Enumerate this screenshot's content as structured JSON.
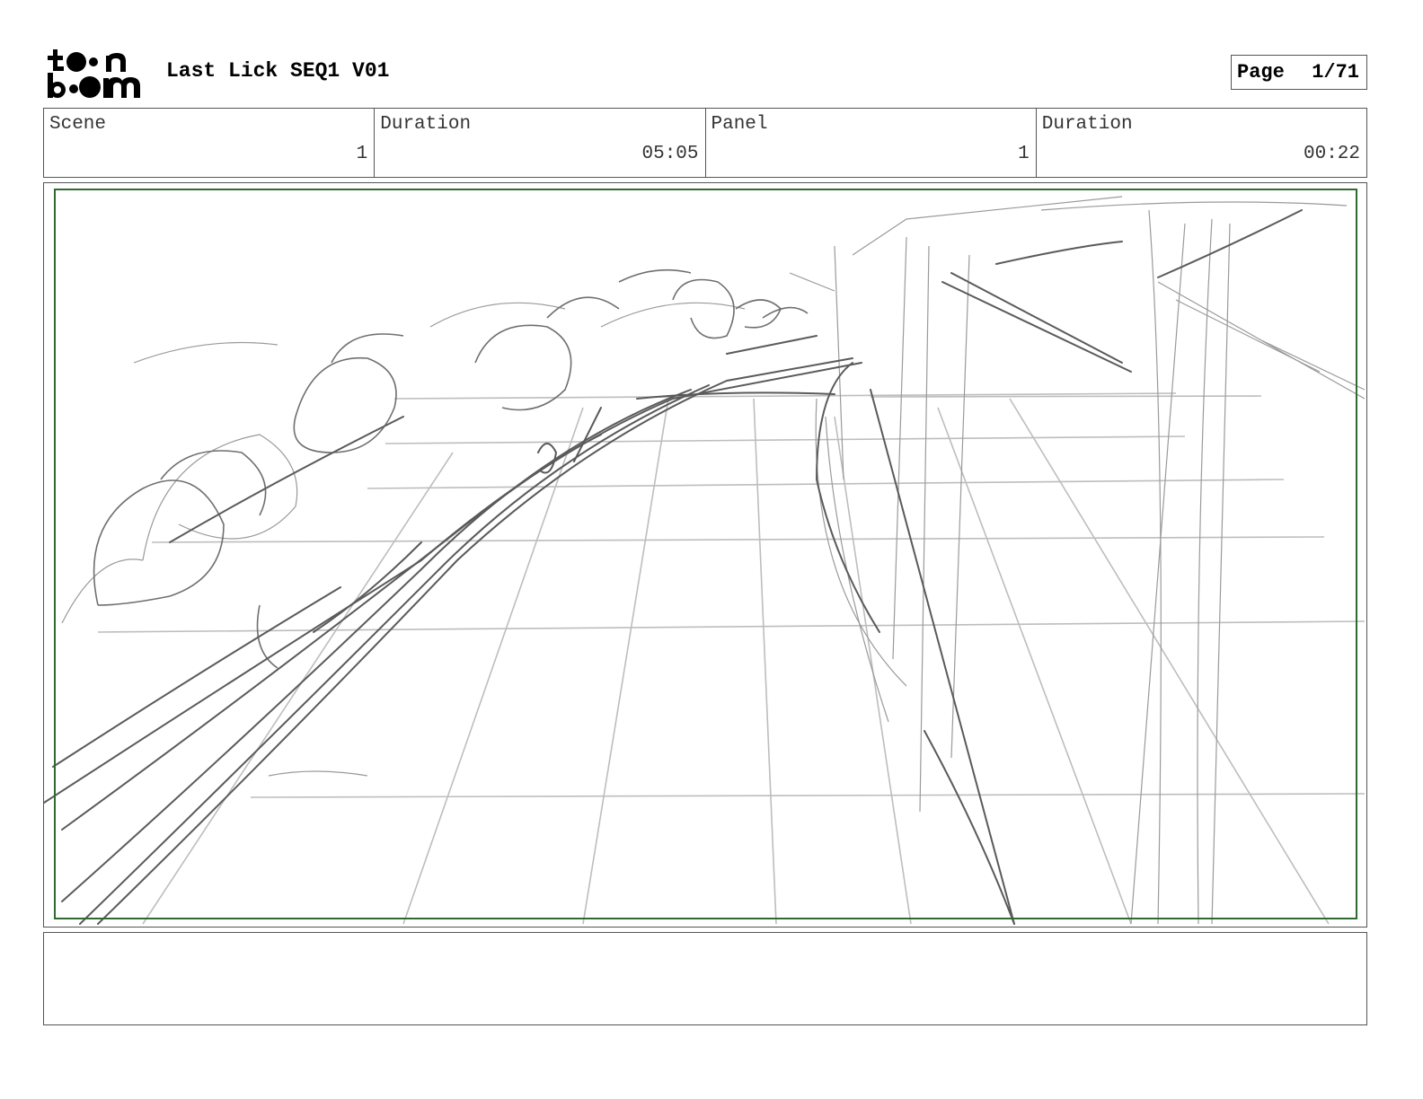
{
  "header": {
    "logo_text": "toon boom",
    "project_title": "Last Lick SEQ1 V01",
    "page_label": "Page",
    "page_number": "1/71"
  },
  "info": {
    "scene_label": "Scene",
    "scene_value": "1",
    "scene_duration_label": "Duration",
    "scene_duration_value": "05:05",
    "panel_label": "Panel",
    "panel_value": "1",
    "panel_duration_label": "Duration",
    "panel_duration_value": "00:22"
  },
  "panel": {
    "safe_area_color": "#2e6b2e",
    "sketch_color": "#6a6a6a",
    "grid_color": "#bdbdbd"
  },
  "notes": {
    "text": ""
  }
}
